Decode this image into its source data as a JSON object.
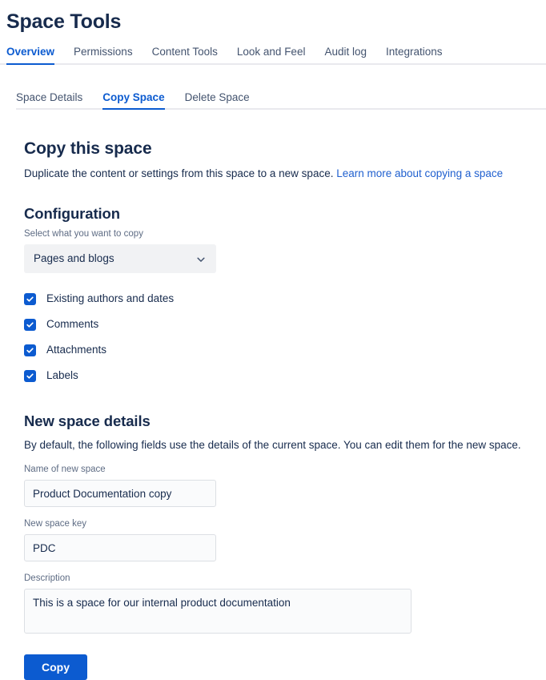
{
  "page": {
    "title": "Space Tools"
  },
  "primary_tabs": [
    {
      "label": "Overview",
      "active": true
    },
    {
      "label": "Permissions",
      "active": false
    },
    {
      "label": "Content Tools",
      "active": false
    },
    {
      "label": "Look and Feel",
      "active": false
    },
    {
      "label": "Audit log",
      "active": false
    },
    {
      "label": "Integrations",
      "active": false
    }
  ],
  "secondary_tabs": [
    {
      "label": "Space Details",
      "active": false
    },
    {
      "label": "Copy Space",
      "active": true
    },
    {
      "label": "Delete Space",
      "active": false
    }
  ],
  "main": {
    "heading": "Copy this space",
    "lead_text": "Duplicate the content or settings from this space to a new space. ",
    "lead_link": "Learn more about copying a space",
    "configuration": {
      "heading": "Configuration",
      "select_label": "Select what you want to copy",
      "select_value": "Pages and blogs",
      "select_icon": "chevron-down-icon",
      "checkboxes": [
        {
          "label": "Existing authors and dates",
          "checked": true
        },
        {
          "label": "Comments",
          "checked": true
        },
        {
          "label": "Attachments",
          "checked": true
        },
        {
          "label": "Labels",
          "checked": true
        }
      ]
    },
    "new_space": {
      "heading": "New space details",
      "description": "By default, the following fields use the details of the current space. You can edit them for the new space.",
      "name_label": "Name of new space",
      "name_value": "Product Documentation copy",
      "key_label": "New space key",
      "key_value": "PDC",
      "desc_label": "Description",
      "desc_value": "This is a space for our internal product documentation"
    },
    "submit_label": "Copy"
  },
  "colors": {
    "accent": "#0C5BD0",
    "text": "#172B4D",
    "muted": "#5E6C84",
    "divider": "#E9E9EE",
    "input_bg": "#FAFBFC",
    "select_bg": "#F1F2F4"
  }
}
